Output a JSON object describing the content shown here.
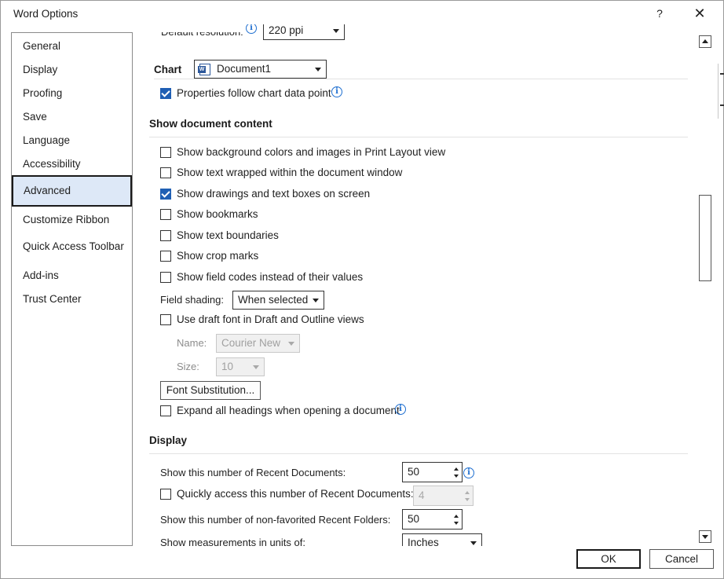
{
  "window": {
    "title": "Word Options",
    "help_label": "?",
    "close_label": "✕"
  },
  "nav": {
    "items": [
      {
        "label": "General"
      },
      {
        "label": "Display"
      },
      {
        "label": "Proofing"
      },
      {
        "label": "Save"
      },
      {
        "label": "Language"
      },
      {
        "label": "Accessibility"
      },
      {
        "label": "Advanced",
        "active": true
      },
      {
        "label": "Customize Ribbon"
      },
      {
        "label": "Quick Access Toolbar"
      },
      {
        "label": "Add-ins"
      },
      {
        "label": "Trust Center"
      }
    ]
  },
  "top_partial": {
    "label": "Default resolution:",
    "value": "220 ppi"
  },
  "chart": {
    "label": "Chart",
    "document_select": "Document1",
    "properties_follow": {
      "label": "Properties follow chart data point",
      "checked": true
    }
  },
  "show_document_content": {
    "heading": "Show document content",
    "options": [
      {
        "label": "Show background colors and images in Print Layout view",
        "checked": false
      },
      {
        "label": "Show text wrapped within the document window",
        "checked": false
      },
      {
        "label": "Show drawings and text boxes on screen",
        "checked": true
      },
      {
        "label": "Show bookmarks",
        "checked": false
      },
      {
        "label": "Show text boundaries",
        "checked": false
      },
      {
        "label": "Show crop marks",
        "checked": false
      },
      {
        "label": "Show field codes instead of their values",
        "checked": false
      }
    ],
    "field_shading": {
      "label": "Field shading:",
      "value": "When selected"
    },
    "draft_font": {
      "label": "Use draft font in Draft and Outline views",
      "checked": false
    },
    "name": {
      "label": "Name:",
      "value": "Courier New"
    },
    "size": {
      "label": "Size:",
      "value": "10"
    },
    "font_substitution_button": "Font Substitution...",
    "expand_headings": {
      "label": "Expand all headings when opening a document",
      "checked": false
    }
  },
  "display": {
    "heading": "Display",
    "recent_documents": {
      "label": "Show this number of Recent Documents:",
      "value": "50"
    },
    "quick_access": {
      "label": "Quickly access this number of Recent Documents:",
      "value": "4",
      "checked": false
    },
    "recent_folders": {
      "label": "Show this number of non-favorited Recent Folders:",
      "value": "50"
    },
    "measurements": {
      "label": "Show measurements in units of:",
      "value": "Inches"
    }
  },
  "footer": {
    "ok_label": "OK",
    "cancel_label": "Cancel"
  },
  "colors": {
    "accent": "#1f5fb4",
    "nav_active_bg": "#dde8f7",
    "info_blue": "#1f6fd0"
  }
}
